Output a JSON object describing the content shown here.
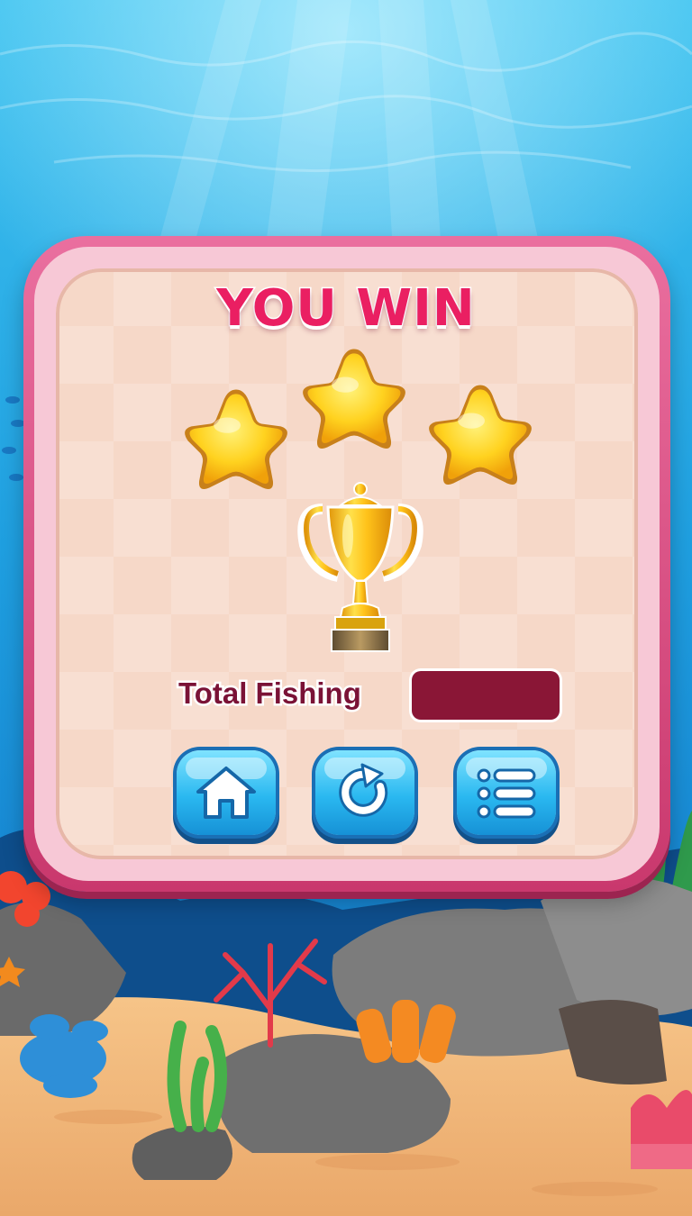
{
  "result": {
    "title": "YOU WIN",
    "stars_earned": 3,
    "stars_total": 3,
    "total_fishing_label": "Total Fishing",
    "total_fishing_value": ""
  },
  "buttons": {
    "home_icon": "home-icon",
    "replay_icon": "replay-icon",
    "menu_icon": "list-menu-icon"
  },
  "colors": {
    "title": "#ea1f62",
    "panel_border": "#c9386d",
    "panel_face": "#f6d8c8",
    "value_box": "#8a1636",
    "button": "#2ab8f0",
    "star": "#ffc928"
  }
}
